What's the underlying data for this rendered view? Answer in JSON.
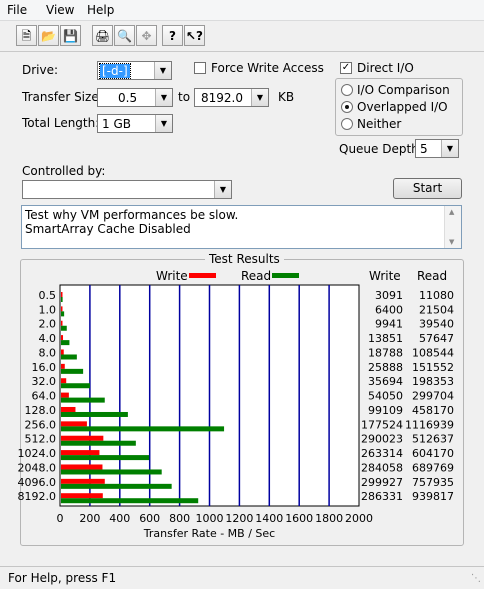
{
  "menu": {
    "file": "File",
    "view": "View",
    "help": "Help"
  },
  "toolbar_icons": [
    "new-icon",
    "open-icon",
    "save-icon",
    "print-icon",
    "print-preview-icon",
    "move-icon",
    "help-icon",
    "context-help-icon"
  ],
  "drive": {
    "label": "Drive:",
    "value": "[-d-]"
  },
  "force_write": {
    "label": "Force Write Access",
    "checked": false
  },
  "direct_io": {
    "label": "Direct I/O",
    "checked": true
  },
  "transfer": {
    "label": "Transfer Size:",
    "from": "0.5",
    "to_label": "to",
    "to": "8192.0",
    "unit": "KB"
  },
  "total_length": {
    "label": "Total Length:",
    "value": "1 GB"
  },
  "io_mode": {
    "options": [
      {
        "label": "I/O Comparison",
        "selected": false
      },
      {
        "label": "Overlapped I/O",
        "selected": true
      },
      {
        "label": "Neither",
        "selected": false
      }
    ]
  },
  "queue_depth": {
    "label": "Queue Depth:",
    "value": "5"
  },
  "controlled_by": {
    "label": "Controlled by:",
    "value": ""
  },
  "start_button": "Start",
  "description": {
    "line1": "Test why VM performances be slow.",
    "line2": "SmartArray Cache Disabled"
  },
  "results": {
    "title": "Test Results",
    "write_label": "Write",
    "read_label": "Read",
    "col_write": "Write",
    "col_read": "Read",
    "xlabel": "Transfer Rate - MB / Sec",
    "colors": {
      "write": "#ff0000",
      "read": "#007f00",
      "grid": "#0000a0"
    }
  },
  "chart_data": {
    "type": "bar",
    "orientation": "horizontal",
    "title": "Test Results",
    "xlabel": "Transfer Rate - MB / Sec",
    "ylabel": "",
    "xlim": [
      0,
      2000
    ],
    "xticks": [
      0,
      200,
      400,
      600,
      800,
      1000,
      1200,
      1400,
      1600,
      1800,
      2000
    ],
    "categories": [
      "0.5",
      "1.0",
      "2.0",
      "4.0",
      "8.0",
      "16.0",
      "32.0",
      "64.0",
      "128.0",
      "256.0",
      "512.0",
      "1024.0",
      "2048.0",
      "4096.0",
      "8192.0"
    ],
    "series": [
      {
        "name": "Write",
        "values_kb": [
          3091,
          6400,
          9941,
          13851,
          18788,
          25888,
          35694,
          54050,
          99109,
          177524,
          290023,
          263314,
          284058,
          299927,
          286331
        ]
      },
      {
        "name": "Read",
        "values_kb": [
          11080,
          21504,
          39540,
          57647,
          108544,
          151552,
          198353,
          299704,
          458170,
          1116939,
          512637,
          604170,
          689769,
          757935,
          939817
        ]
      }
    ]
  },
  "status": "For Help, press F1"
}
